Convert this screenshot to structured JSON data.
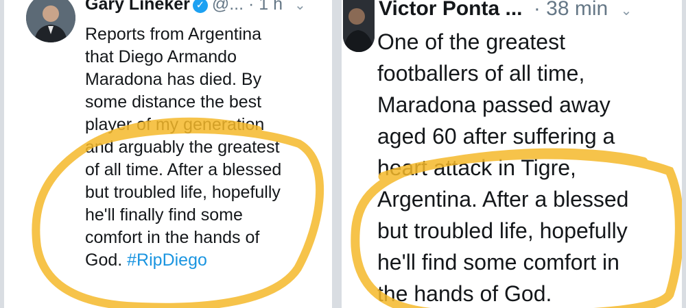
{
  "left_tweet": {
    "author": "Gary Lineker",
    "handle": "@...",
    "time": "· 1 h",
    "lines": [
      "Reports from Argentina",
      "that Diego Armando",
      "Maradona has died. By",
      "some distance the best",
      "player of my generation",
      "and arguably the greatest",
      "of all time. After a blessed",
      "but troubled life, hopefully",
      "he'll finally find some",
      "comfort in the hands of",
      "God."
    ],
    "hashtag": "#RipDiego"
  },
  "right_tweet": {
    "author": "Victor Ponta ...",
    "time": "· 38 min",
    "lines": [
      "One of the greatest",
      "footballers of all time,",
      "Maradona passed away",
      "aged 60 after suffering a",
      "heart attack in Tigre,",
      "Argentina. After a blessed",
      "but troubled life, hopefully",
      "he'll find some comfort in",
      "the hands of God."
    ]
  },
  "colors": {
    "highlight": "#f5b82a",
    "link": "#1b95e0",
    "verified": "#1da1f2"
  }
}
